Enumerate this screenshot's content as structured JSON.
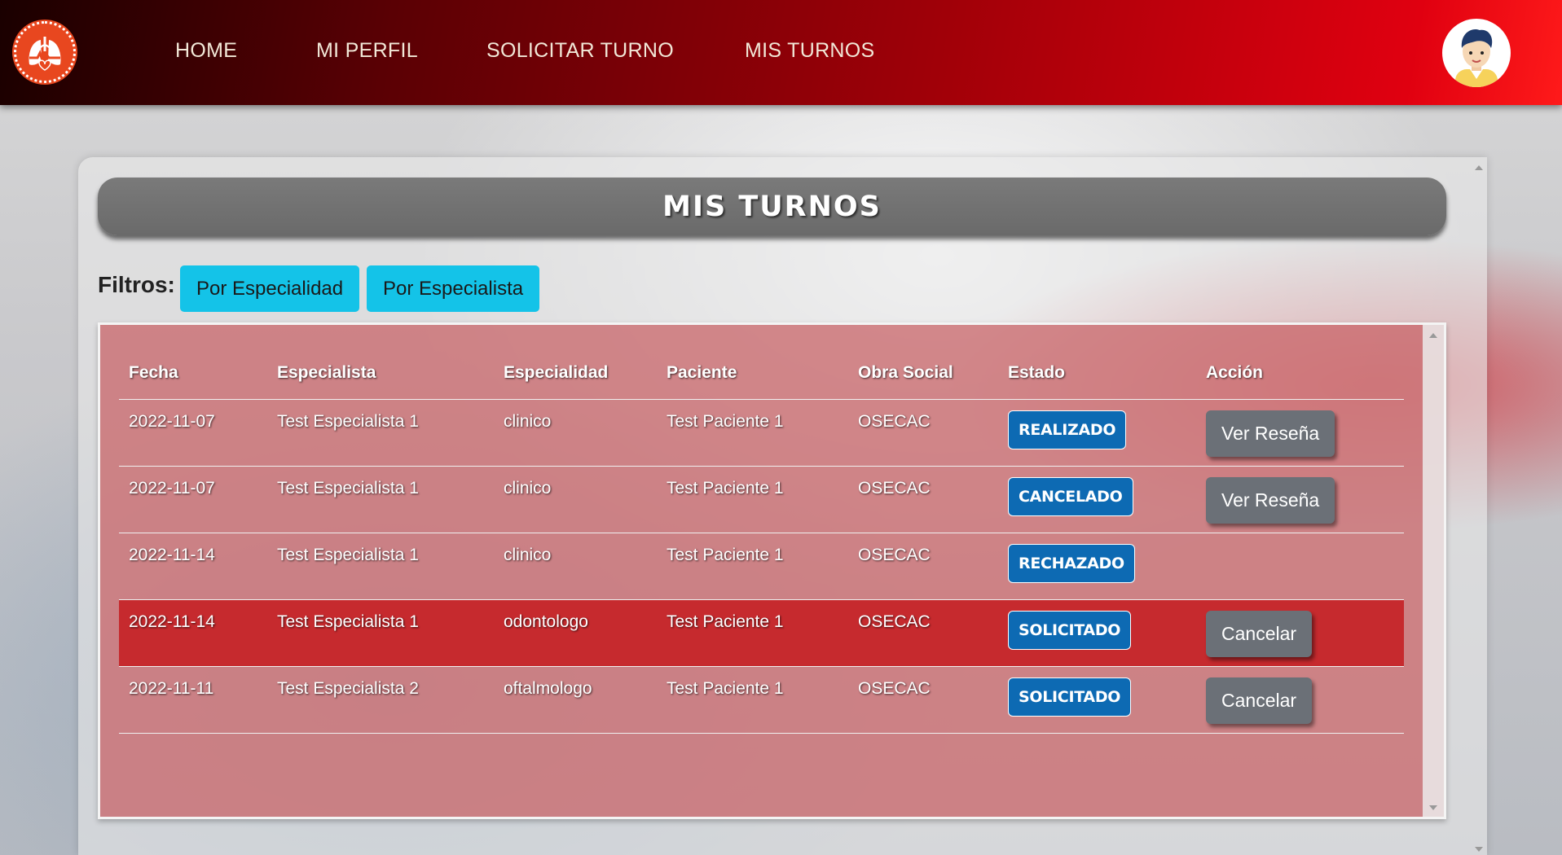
{
  "nav": {
    "links": [
      "HOME",
      "MI PERFIL",
      "SOLICITAR TURNO",
      "MIS TURNOS"
    ]
  },
  "page": {
    "title": "MIS TURNOS"
  },
  "filters": {
    "label": "Filtros:",
    "by_specialty": "Por Especialidad",
    "by_specialist": "Por Especialista"
  },
  "table": {
    "headers": [
      "Fecha",
      "Especialista",
      "Especialidad",
      "Paciente",
      "Obra Social",
      "Estado",
      "Acción"
    ],
    "rows": [
      {
        "fecha": "2022-11-07",
        "especialista": "Test Especialista 1",
        "especialidad": "clinico",
        "paciente": "Test Paciente 1",
        "obra_social": "OSECAC",
        "estado": "REALIZADO",
        "accion": "Ver Reseña"
      },
      {
        "fecha": "2022-11-07",
        "especialista": "Test Especialista 1",
        "especialidad": "clinico",
        "paciente": "Test Paciente 1",
        "obra_social": "OSECAC",
        "estado": "CANCELADO",
        "accion": "Ver Reseña"
      },
      {
        "fecha": "2022-11-14",
        "especialista": "Test Especialista 1",
        "especialidad": "clinico",
        "paciente": "Test Paciente 1",
        "obra_social": "OSECAC",
        "estado": "RECHAZADO",
        "accion": ""
      },
      {
        "fecha": "2022-11-14",
        "especialista": "Test Especialista 1",
        "especialidad": "odontologo",
        "paciente": "Test Paciente 1",
        "obra_social": "OSECAC",
        "estado": "SOLICITADO",
        "accion": "Cancelar"
      },
      {
        "fecha": "2022-11-11",
        "especialista": "Test Especialista 2",
        "especialidad": "oftalmologo",
        "paciente": "Test Paciente 1",
        "obra_social": "OSECAC",
        "estado": "SOLICITADO",
        "accion": "Cancelar"
      }
    ]
  },
  "colors": {
    "nav_gradient_end": "#ff1a1a",
    "filter_button": "#14c3e8",
    "status_badge": "#0d6ab3",
    "action_button": "#6b7077",
    "highlight_row": "#c62a2e"
  },
  "icons": {
    "logo": "lungs-heartbeat-logo-icon",
    "avatar": "user-avatar-icon"
  }
}
